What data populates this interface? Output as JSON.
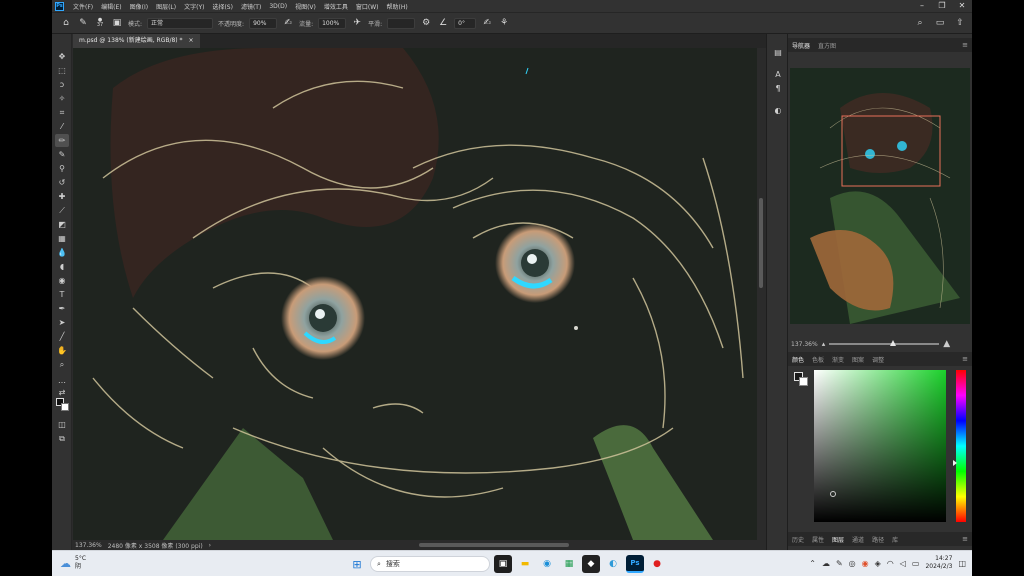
{
  "menubar": {
    "logo": "Ps",
    "items": [
      "文件(F)",
      "编辑(E)",
      "图像(I)",
      "图层(L)",
      "文字(Y)",
      "选择(S)",
      "滤镜(T)",
      "3D(D)",
      "视图(V)",
      "增效工具",
      "窗口(W)",
      "帮助(H)"
    ]
  },
  "options": {
    "brush_size": "37",
    "mode_label": "模式:",
    "mode_value": "正常",
    "opacity_label": "不透明度:",
    "opacity_value": "90%",
    "flow_label": "流量:",
    "flow_value": "100%",
    "smooth_label": "平滑:",
    "smooth_value": "",
    "angle_value": "0°"
  },
  "document": {
    "tab_title": "m.psd @ 138% (新建绘画, RGB/8) *",
    "close": "×"
  },
  "status": {
    "zoom": "137.36%",
    "size": "2480 像素 x 3508 像素 (300 ppi)",
    "arrow": "›"
  },
  "panels": {
    "top_tabs": [
      "导航器",
      "直方图"
    ],
    "zoom_value": "137.36%",
    "zoom_fraction": 0.58,
    "color_tabs": [
      "颜色",
      "色板",
      "渐变",
      "图案",
      "调整"
    ],
    "bottom_tabs": [
      "历史",
      "属性",
      "图层",
      "通道",
      "路径",
      "库"
    ],
    "active_bottom": "图层"
  },
  "taskbar": {
    "temp": "5°C",
    "weather": "阴",
    "search": "搜索",
    "time": "14:27",
    "date": "2024/2/3"
  },
  "colors": {
    "accent": "#31a8ff",
    "nav_box": "#e8705a",
    "eye_cyan": "#2fd8ff",
    "picker_hue": "#1bd12b"
  },
  "icons": {
    "tools": [
      "move-icon",
      "marquee-icon",
      "lasso-icon",
      "quick-select-icon",
      "crop-icon",
      "eyedropper-icon",
      "brush-icon",
      "pencil-icon",
      "clone-stamp-icon",
      "history-brush-icon",
      "eraser-icon",
      "gradient-icon",
      "blur-icon",
      "dodge-icon",
      "pen-icon",
      "type-icon",
      "path-select-icon",
      "shape-icon",
      "hand-icon",
      "zoom-icon"
    ]
  }
}
